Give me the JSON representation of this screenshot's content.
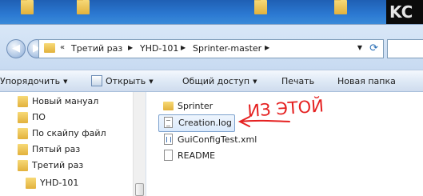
{
  "desktop": {
    "corner_logo_text": "KC",
    "icons": [
      "folder-icon",
      "folder-icon",
      "folder-icon",
      "folder-icon"
    ]
  },
  "address": {
    "overflow": "«",
    "breadcrumbs": [
      "Третий раз",
      "YHD-101",
      "Sprinter-master"
    ]
  },
  "toolbar": {
    "organize": "Упорядочить",
    "open": "Открыть",
    "share": "Общий доступ",
    "print": "Печать",
    "new_folder": "Новая папка"
  },
  "navigation": {
    "items": [
      {
        "label": "Новый мануал",
        "icon": "folder-icon"
      },
      {
        "label": "ПО",
        "icon": "folder-icon"
      },
      {
        "label": "По скайпу файл",
        "icon": "folder-icon"
      },
      {
        "label": "Пятый раз",
        "icon": "folder-icon"
      },
      {
        "label": "Третий раз",
        "icon": "folder-icon"
      },
      {
        "label": "YHD-101",
        "icon": "folder-icon"
      }
    ]
  },
  "files": [
    {
      "name": "Sprinter",
      "type": "folder",
      "selected": false
    },
    {
      "name": "Creation.log",
      "type": "text-document",
      "selected": true
    },
    {
      "name": "GuiConfigTest.xml",
      "type": "xml-document",
      "selected": false
    },
    {
      "name": "README",
      "type": "document",
      "selected": false
    }
  ],
  "annotation": {
    "text": "ИЗ ЭТОЙ",
    "color": "#e52121"
  },
  "colors": {
    "selection_border": "#7da2ce",
    "window_frame": "#c7daf1"
  }
}
